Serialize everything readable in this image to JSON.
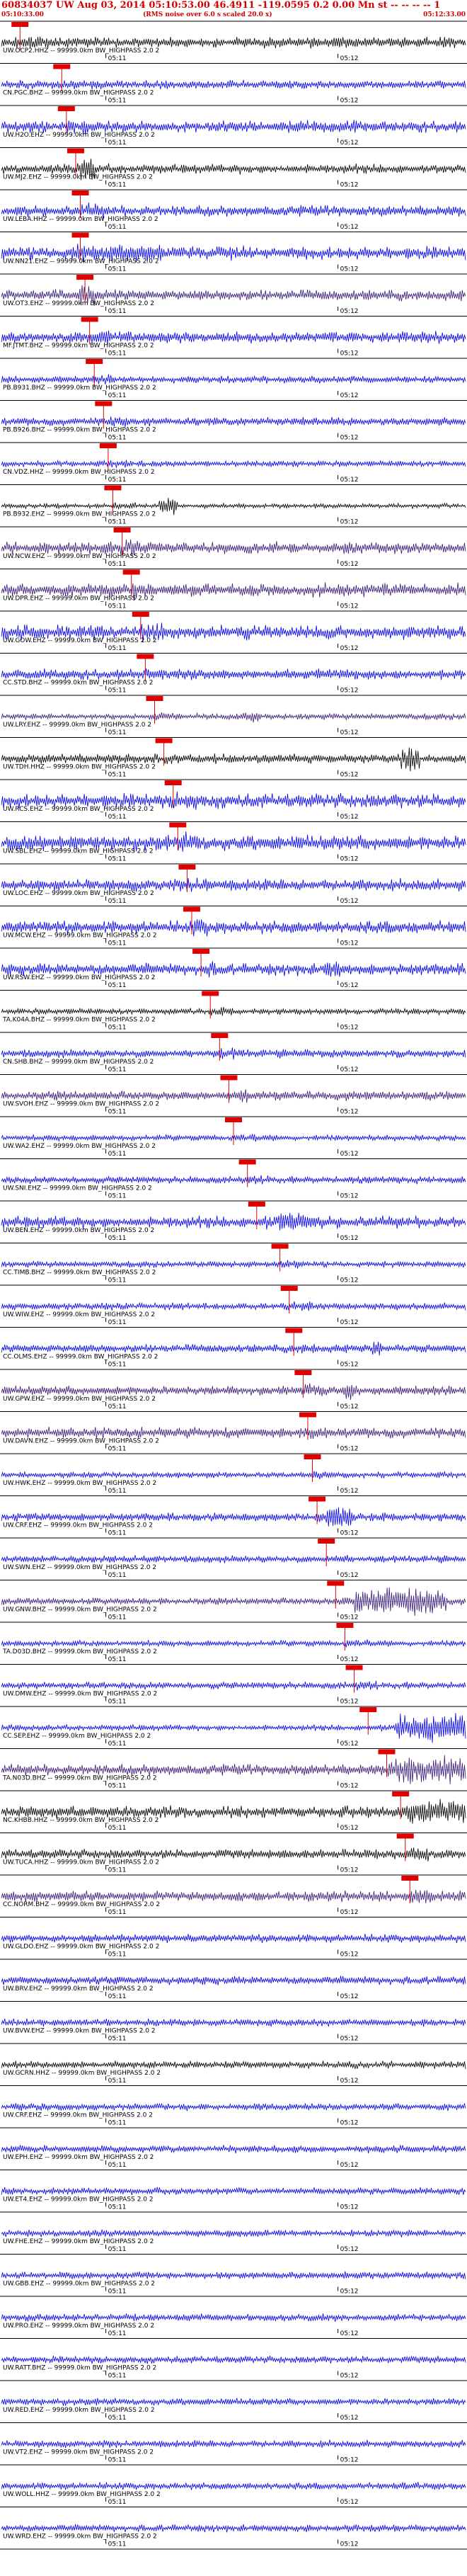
{
  "header": {
    "title": "60834037 UW Aug 03, 2014 05:10:53.00   46.4911  -119.0595  0.2 0.00 Mn st -- -- -- -- 1",
    "subtitle": "(RMS noise over 6.0 s scaled 20.0 x)",
    "start_time": "05:10:33.00",
    "end_time": "05:12:33.00"
  },
  "colors": {
    "pick": "#e00000",
    "trace_palette": [
      "#000000",
      "#0000ee",
      "#3a1a7a"
    ]
  },
  "chart_data": {
    "type": "line",
    "title": "60834037 UW Aug 03, 2014 05:10:53.00",
    "time_window": [
      "05:10:33.00",
      "05:12:33.00"
    ],
    "minute_ticks": [
      "05:11",
      "05:12"
    ],
    "minute_tick_fraction": [
      0.225,
      0.725
    ],
    "channel_suffix": "-- 99999.0km BW_HIGHPASS  2.0  2",
    "stations": [
      {
        "name": "UW.OCP2.HHZ",
        "color": 0,
        "amp": 9,
        "pick": 0.04,
        "burst": null
      },
      {
        "name": "CN.PGC.BHZ",
        "color": 1,
        "amp": 7,
        "pick": 0.13,
        "burst": null
      },
      {
        "name": "UW.H2O.EHZ",
        "color": 1,
        "amp": 10,
        "pick": 0.14,
        "burst": null
      },
      {
        "name": "UW.MJ2.EHZ",
        "color": 0,
        "amp": 8,
        "pick": 0.16,
        "burst": [
          0.17,
          0.2,
          18
        ]
      },
      {
        "name": "UW.LEBA.HHZ",
        "color": 1,
        "amp": 9,
        "pick": 0.17,
        "burst": null
      },
      {
        "name": "UW.NN21.EHZ",
        "color": 1,
        "amp": 11,
        "pick": 0.17,
        "burst": [
          0.15,
          0.35,
          14
        ]
      },
      {
        "name": "UW.OT3.EHZ",
        "color": 2,
        "amp": 9,
        "pick": 0.18,
        "burst": [
          0.16,
          0.2,
          16
        ]
      },
      {
        "name": "MF.JTMT.BHZ",
        "color": 1,
        "amp": 10,
        "pick": 0.19,
        "burst": null
      },
      {
        "name": "PB.B931.BHZ",
        "color": 1,
        "amp": 6,
        "pick": 0.2,
        "burst": null
      },
      {
        "name": "PB.B926.BHZ",
        "color": 1,
        "amp": 7,
        "pick": 0.22,
        "burst": null
      },
      {
        "name": "CN.VDZ.HHZ",
        "color": 1,
        "amp": 5,
        "pick": 0.23,
        "burst": null
      },
      {
        "name": "PB.B932.EHZ",
        "color": 0,
        "amp": 4,
        "pick": 0.24,
        "burst": [
          0.34,
          0.38,
          14
        ]
      },
      {
        "name": "UW.NCW.EHZ",
        "color": 2,
        "amp": 10,
        "pick": 0.26,
        "burst": null
      },
      {
        "name": "UW.DPR.EHZ",
        "color": 2,
        "amp": 11,
        "pick": 0.28,
        "burst": null
      },
      {
        "name": "UW.GOW.EHZ",
        "color": 1,
        "amp": 12,
        "pick": 0.3,
        "burst": null
      },
      {
        "name": "CC.STD.BHZ",
        "color": 1,
        "amp": 9,
        "pick": 0.31,
        "burst": null
      },
      {
        "name": "UW.LRY.EHZ",
        "color": 2,
        "amp": 5,
        "pick": 0.33,
        "burst": [
          0.52,
          0.56,
          10
        ]
      },
      {
        "name": "UW.TDH.HHZ",
        "color": 0,
        "amp": 8,
        "pick": 0.35,
        "burst": [
          0.86,
          0.9,
          18
        ]
      },
      {
        "name": "UW.RCS.EHZ",
        "color": 1,
        "amp": 12,
        "pick": 0.37,
        "burst": null
      },
      {
        "name": "UW.SBL.EHZ",
        "color": 1,
        "amp": 13,
        "pick": 0.38,
        "burst": null
      },
      {
        "name": "UW.LOC.EHZ",
        "color": 1,
        "amp": 10,
        "pick": 0.4,
        "burst": null
      },
      {
        "name": "UW.MCW.EHZ",
        "color": 1,
        "amp": 11,
        "pick": 0.41,
        "burst": null
      },
      {
        "name": "UW.RSW.EHZ",
        "color": 1,
        "amp": 10,
        "pick": 0.43,
        "burst": [
          0.7,
          0.73,
          14
        ]
      },
      {
        "name": "TA.K04A.BHZ",
        "color": 0,
        "amp": 5,
        "pick": 0.45,
        "burst": null
      },
      {
        "name": "CN.SHB.BHZ",
        "color": 1,
        "amp": 7,
        "pick": 0.47,
        "burst": null
      },
      {
        "name": "UW.SVOH.EHZ",
        "color": 2,
        "amp": 8,
        "pick": 0.49,
        "burst": null
      },
      {
        "name": "UW.WA2.EHZ",
        "color": 1,
        "amp": 5,
        "pick": 0.5,
        "burst": null
      },
      {
        "name": "UW.SNI.EHZ",
        "color": 1,
        "amp": 6,
        "pick": 0.53,
        "burst": null
      },
      {
        "name": "UW.BEN.EHZ",
        "color": 1,
        "amp": 10,
        "pick": 0.55,
        "burst": [
          0.6,
          0.66,
          18
        ]
      },
      {
        "name": "CC.TIMB.BHZ",
        "color": 1,
        "amp": 5,
        "pick": 0.6,
        "burst": null
      },
      {
        "name": "UW.WIW.EHZ",
        "color": 1,
        "amp": 6,
        "pick": 0.62,
        "burst": null
      },
      {
        "name": "CC.OLMS.EHZ",
        "color": 1,
        "amp": 7,
        "pick": 0.63,
        "burst": [
          0.8,
          0.82,
          14
        ]
      },
      {
        "name": "UW.GPW.EHZ",
        "color": 2,
        "amp": 8,
        "pick": 0.65,
        "burst": [
          0.74,
          0.76,
          14
        ]
      },
      {
        "name": "UW.DAVN.EHZ",
        "color": 2,
        "amp": 9,
        "pick": 0.66,
        "burst": null
      },
      {
        "name": "UW.HWK.EHZ",
        "color": 1,
        "amp": 5,
        "pick": 0.67,
        "burst": null
      },
      {
        "name": "UW.CRF.EHZ",
        "color": 1,
        "amp": 7,
        "pick": 0.68,
        "burst": [
          0.7,
          0.76,
          18
        ]
      },
      {
        "name": "UW.SWN.EHZ",
        "color": 1,
        "amp": 6,
        "pick": 0.7,
        "burst": null
      },
      {
        "name": "UW.GNW.BHZ",
        "color": 2,
        "amp": 6,
        "pick": 0.72,
        "burst": [
          0.76,
          0.96,
          22
        ]
      },
      {
        "name": "TA.D03D.BHZ",
        "color": 1,
        "amp": 5,
        "pick": 0.74,
        "burst": null
      },
      {
        "name": "UW.DMW.EHZ",
        "color": 1,
        "amp": 6,
        "pick": 0.76,
        "burst": null
      },
      {
        "name": "CC.SEP.EHZ",
        "color": 1,
        "amp": 5,
        "pick": 0.79,
        "burst": [
          0.85,
          1.0,
          22
        ]
      },
      {
        "name": "TA.N03D.BHZ",
        "color": 2,
        "amp": 9,
        "pick": 0.83,
        "burst": [
          0.85,
          1.0,
          22
        ]
      },
      {
        "name": "NC.KHBB.HHZ",
        "color": 0,
        "amp": 10,
        "pick": 0.86,
        "burst": [
          0.88,
          1.0,
          20
        ]
      },
      {
        "name": "UW.TUCA.HHZ",
        "color": 0,
        "amp": 8,
        "pick": 0.87,
        "burst": [
          0.88,
          0.92,
          14
        ]
      },
      {
        "name": "CC.NORM.BHZ",
        "color": 2,
        "amp": 9,
        "pick": 0.88,
        "burst": [
          0.88,
          0.9,
          16
        ]
      },
      {
        "name": "UW.GLDO.EHZ",
        "color": 1,
        "amp": 7,
        "pick": null,
        "burst": null
      },
      {
        "name": "UW.BRV.EHZ",
        "color": 1,
        "amp": 7,
        "pick": null,
        "burst": null
      },
      {
        "name": "UW.BVW.EHZ",
        "color": 1,
        "amp": 6,
        "pick": null,
        "burst": null
      },
      {
        "name": "UW.GCRN.HHZ",
        "color": 0,
        "amp": 6,
        "pick": null,
        "burst": null
      },
      {
        "name": "UW.CRF.EHZ",
        "color": 1,
        "amp": 6,
        "pick": null,
        "burst": null
      },
      {
        "name": "UW.EPH.EHZ",
        "color": 1,
        "amp": 6,
        "pick": null,
        "burst": null
      },
      {
        "name": "UW.ET4.EHZ",
        "color": 1,
        "amp": 6,
        "pick": null,
        "burst": null
      },
      {
        "name": "UW.FHE.EHZ",
        "color": 1,
        "amp": 6,
        "pick": null,
        "burst": null
      },
      {
        "name": "UW.GBB.EHZ",
        "color": 1,
        "amp": 6,
        "pick": null,
        "burst": null
      },
      {
        "name": "UW.PRO.EHZ",
        "color": 1,
        "amp": 6,
        "pick": null,
        "burst": null
      },
      {
        "name": "UW.RATT.BHZ",
        "color": 1,
        "amp": 6,
        "pick": null,
        "burst": null
      },
      {
        "name": "UW.RED.EHZ",
        "color": 1,
        "amp": 6,
        "pick": null,
        "burst": null
      },
      {
        "name": "UW.VT2.EHZ",
        "color": 1,
        "amp": 6,
        "pick": null,
        "burst": null
      },
      {
        "name": "UW.WOLL.HHZ",
        "color": 1,
        "amp": 6,
        "pick": null,
        "burst": null
      },
      {
        "name": "UW.WRD.EHZ",
        "color": 1,
        "amp": 6,
        "pick": null,
        "burst": null
      }
    ]
  }
}
